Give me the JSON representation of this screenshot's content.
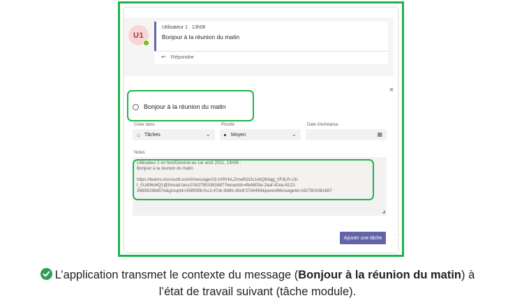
{
  "message": {
    "avatar_initials": "U1",
    "author": "Utilisateur 1",
    "time": "13h06",
    "text": "Bonjour à la réunion du matin",
    "reply_label": "Répondre"
  },
  "task_module": {
    "close_glyph": "×",
    "task_title": "Bonjour à la réunion du matin",
    "create_in": {
      "label": "Créer dans",
      "value": "Tâches"
    },
    "priority": {
      "label": "Priorité",
      "value": "Moyen"
    },
    "due_date": {
      "label": "Date d'échéance",
      "value": ""
    },
    "notes": {
      "label": "Notes",
      "line1": "Utilisateur 1 en test/Général au 1er août 2021, 13h06 :",
      "line2": "Bonjour à la réunion du matin",
      "line3": "https://teams.microsoft.com/l/message/19:zXRHvLZmwfh3Oc1vbQKbqg_0FdLR-c3l-",
      "line4": "t_0Ud06o6Q1@thread.tacv2/1627803381687?tenantId=4fe6803e-2aaf-42ea-8122-",
      "line5": "36858198d57e&groupId=358f05fb-fcc2-47dc-8b6b-3bc6'37d4494&parentMessageId=1627803381687"
    },
    "add_button": "Ajouter une tâche"
  },
  "caption": {
    "prefix": "L’application transmet le contexte du message (",
    "bold": "Bonjour à la réunion du matin",
    "suffix": ") à",
    "line2": "l’état de travail suivant (tâche module)."
  },
  "colors": {
    "highlight_green": "#1db34a",
    "teams_purple": "#6264a7",
    "check_green": "#2e9e55"
  }
}
